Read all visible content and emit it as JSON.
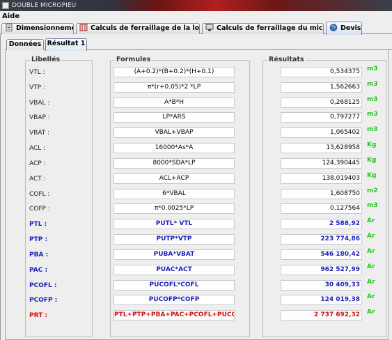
{
  "window": {
    "title": "DOUBLE MICROPIEU"
  },
  "menu": [
    "Aide"
  ],
  "main_tabs": [
    {
      "label": "Dimensionnement",
      "icon": "document-icon"
    },
    {
      "label": "Calculs de ferraillage de la longrine",
      "icon": "rebar-icon"
    },
    {
      "label": "Calculs de ferraillage du micropieu",
      "icon": "monitor-icon"
    },
    {
      "label": "Devis",
      "icon": "globe-icon",
      "active": true
    }
  ],
  "sub_tabs": [
    {
      "label": "Données"
    },
    {
      "label": "Résultat 1",
      "active": true
    }
  ],
  "groups": {
    "libelles": "Libellés",
    "formules": "Formules",
    "resultats": "Résultats"
  },
  "colors": {
    "black_text": "#222222",
    "blue_text": "#1c20b8",
    "red_text": "#d01010",
    "unit_green": "#22c422"
  },
  "rows": [
    {
      "label": "VTL :",
      "formula": "(A+0.2)*(B+0.2)*(H+0.1)",
      "result": "0,534375",
      "unit": "m3",
      "style": "black"
    },
    {
      "label": "VTP :",
      "formula": "π*(r+0.05)*2 *LP",
      "result": "1,562663",
      "unit": "m3",
      "style": "black"
    },
    {
      "label": "VBAL :",
      "formula": "A*B*H",
      "result": "0,268125",
      "unit": "m3",
      "style": "black"
    },
    {
      "label": "VBAP :",
      "formula": "LP*ARS",
      "result": "0,797277",
      "unit": "m3",
      "style": "black"
    },
    {
      "label": "VBAT :",
      "formula": "VBAL+VBAP",
      "result": "1,065402",
      "unit": "m3",
      "style": "black"
    },
    {
      "label": "ACL :",
      "formula": "16000*As*A",
      "result": "13,628958",
      "unit": "Kg",
      "style": "black"
    },
    {
      "label": "ACP :",
      "formula": "8000*SDA*LP",
      "result": "124,390445",
      "unit": "Kg",
      "style": "black"
    },
    {
      "label": "ACT :",
      "formula": "ACL+ACP",
      "result": "138,019403",
      "unit": "Kg",
      "style": "black"
    },
    {
      "label": "COFL :",
      "formula": "6*VBAL",
      "result": "1,608750",
      "unit": "m2",
      "style": "black"
    },
    {
      "label": "COFP :",
      "formula": "π*0.0025*LP",
      "result": "0,127564",
      "unit": "m3",
      "style": "black"
    },
    {
      "label": "PTL :",
      "formula": "PUTL* VTL",
      "result": "2 588,92",
      "unit": "Ar",
      "style": "blue"
    },
    {
      "label": "PTP :",
      "formula": "PUTP*VTP",
      "result": "223 774,86",
      "unit": "Ar",
      "style": "blue"
    },
    {
      "label": "PBA :",
      "formula": "PUBA*VBAT",
      "result": "546 180,42",
      "unit": "Ar",
      "style": "blue"
    },
    {
      "label": "PAC :",
      "formula": "PUAC*ACT",
      "result": "962 527,99",
      "unit": "Ar",
      "style": "blue"
    },
    {
      "label": "PCOFL :",
      "formula": "PUCOFL*COFL",
      "result": "30 409,33",
      "unit": "Ar",
      "style": "blue"
    },
    {
      "label": "PCOFP :",
      "formula": "PUCOFP*COFP",
      "result": "124 019,38",
      "unit": "Ar",
      "style": "blue"
    },
    {
      "label": "PRT :",
      "formula": "PTL+PTP+PBA+PAC+PCOFL+PUCOFP",
      "result": "2 737 692,32",
      "unit": "Ar",
      "style": "red"
    }
  ]
}
